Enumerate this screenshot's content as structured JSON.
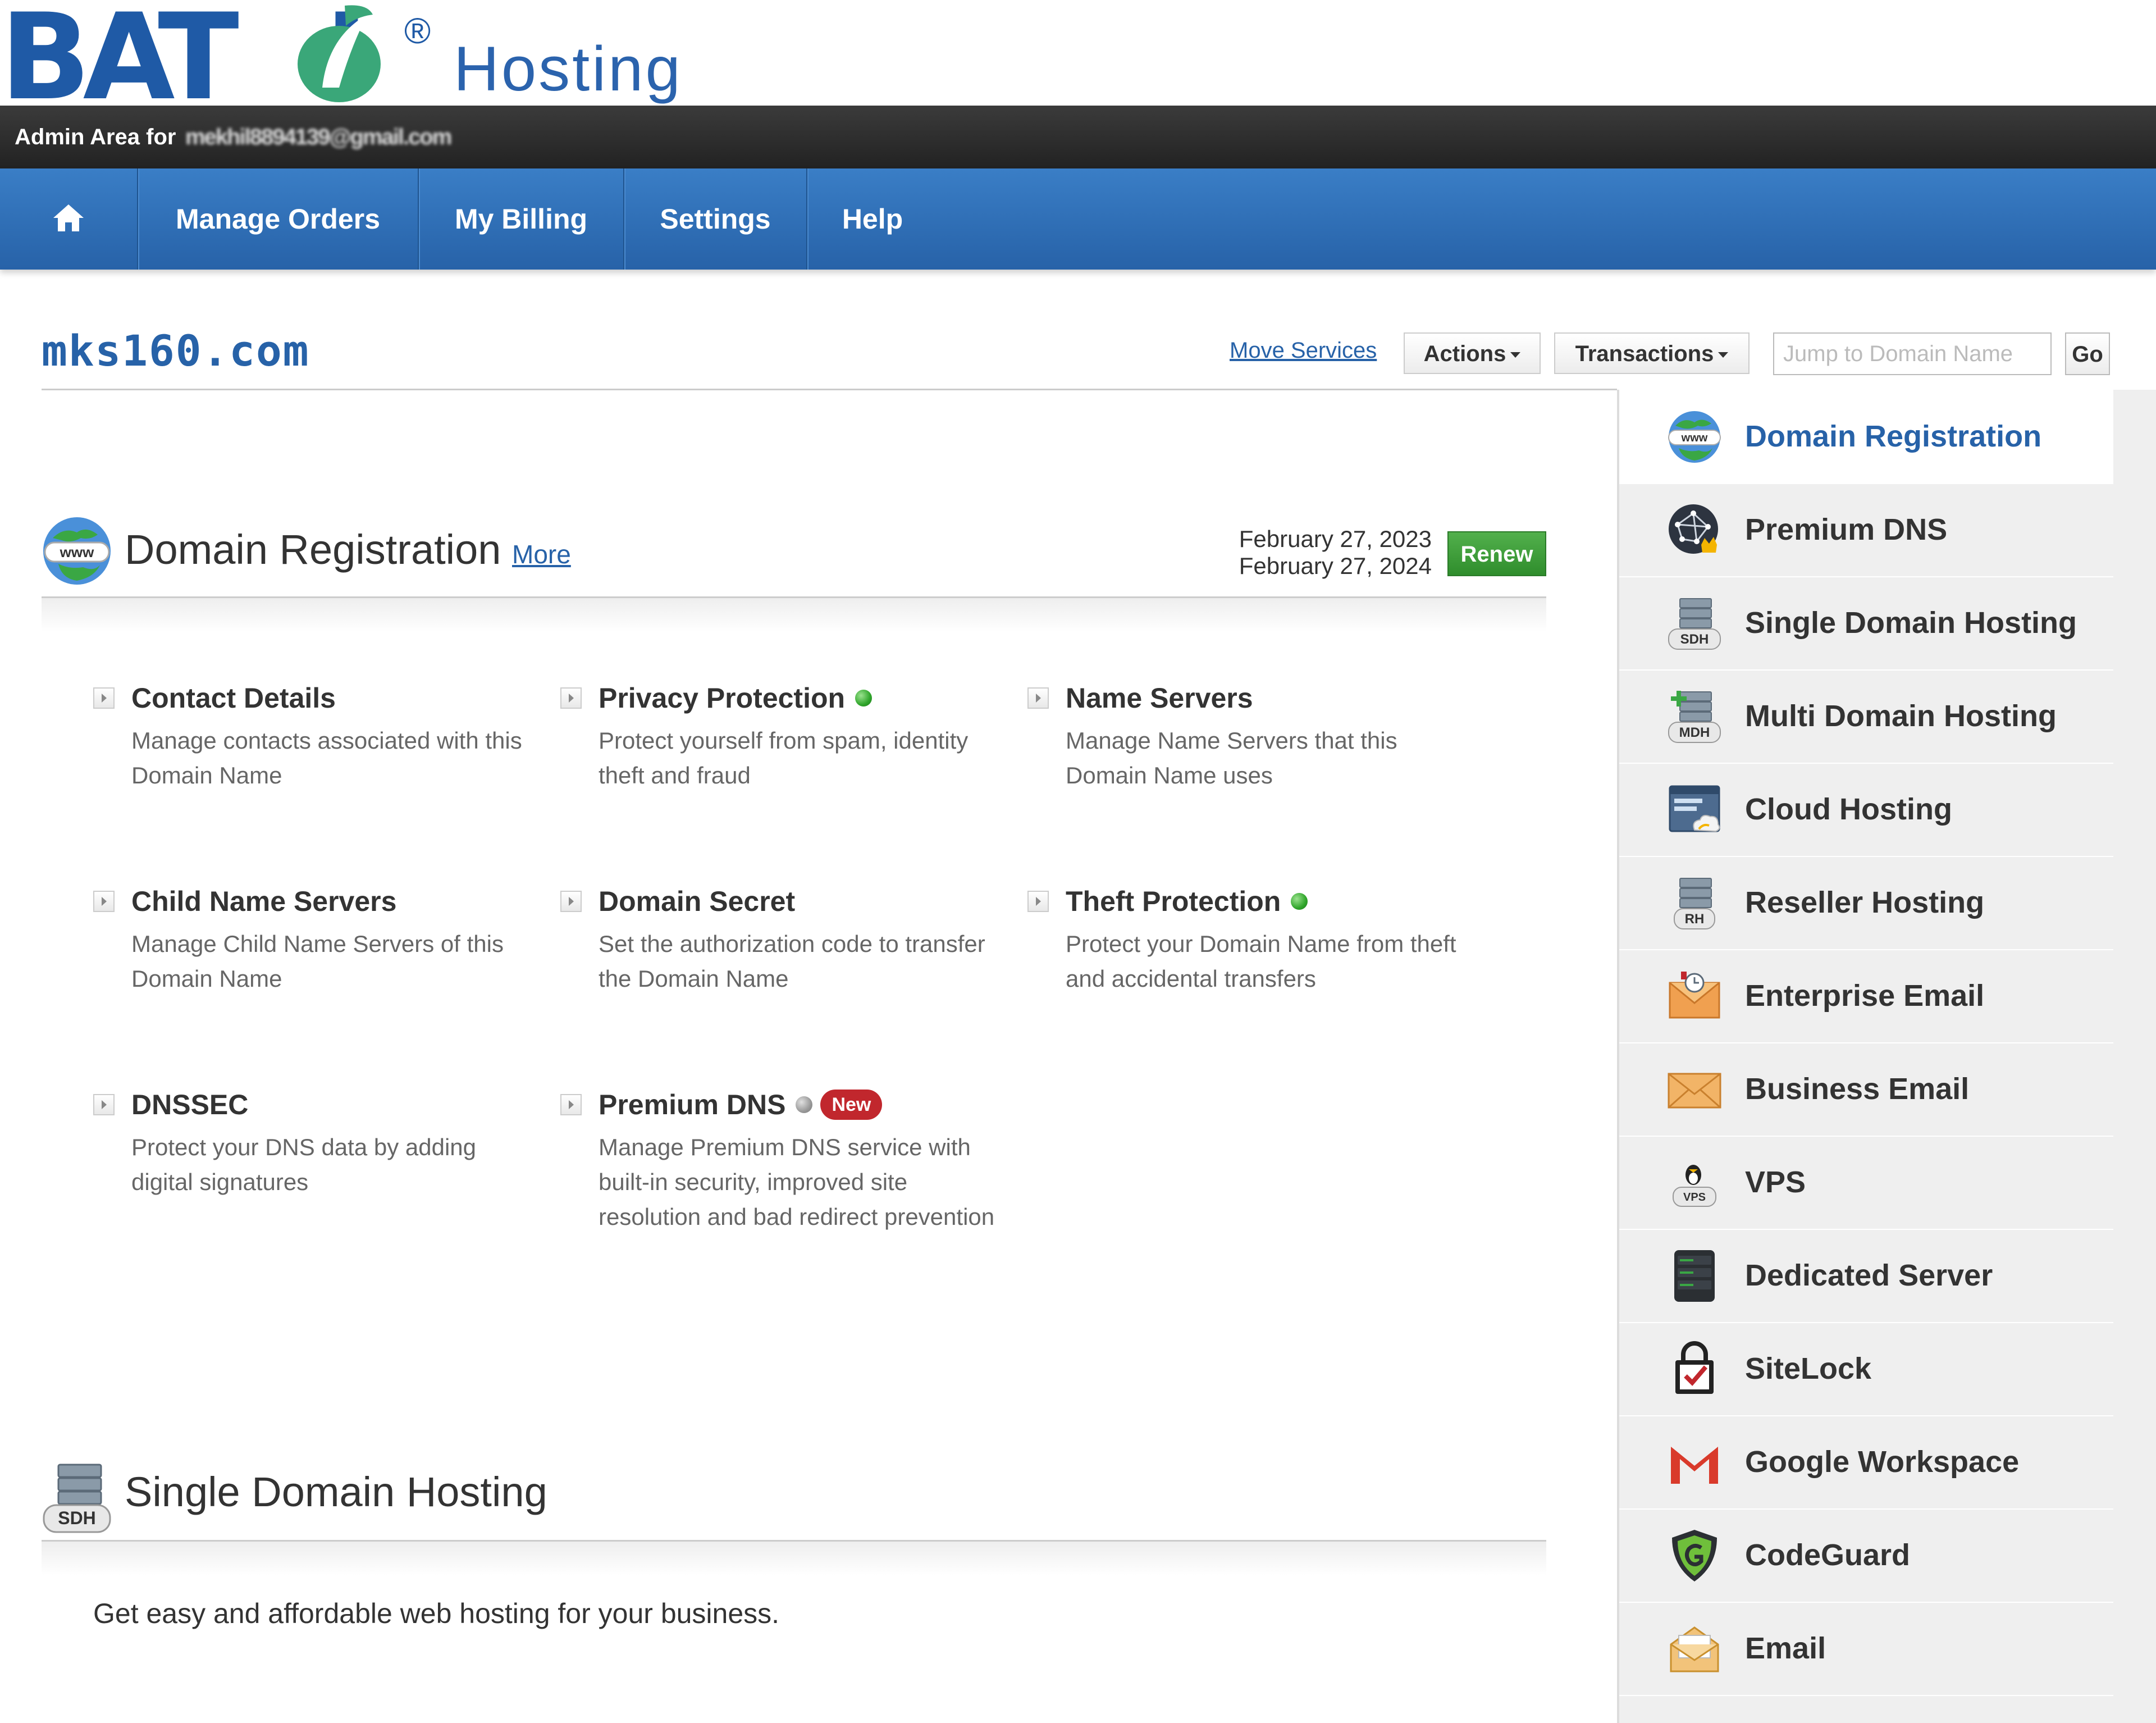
{
  "brand": {
    "logo_word": "BATOI",
    "logo_reg": "®",
    "logo_suffix": "Hosting",
    "color": "#1f5aa6",
    "logo_leaf_color": "#3aa779"
  },
  "admin_bar": {
    "prefix": "Admin Area for",
    "email": "mekhil8894139@gmail.com"
  },
  "nav": {
    "home_icon": "home-icon",
    "items": [
      "Manage Orders",
      "My Billing",
      "Settings",
      "Help"
    ]
  },
  "domain": {
    "name": "mks160.com"
  },
  "toolbar": {
    "move_services": "Move Services",
    "actions": "Actions",
    "transactions": "Transactions",
    "jump_placeholder": "Jump to Domain Name",
    "go": "Go"
  },
  "domain_registration": {
    "title": "Domain Registration",
    "more": "More",
    "date_registered": "February 27, 2023",
    "date_expires": "February 27, 2024",
    "renew": "Renew",
    "features": [
      {
        "title": "Contact Details",
        "desc": "Manage contacts associated with this Domain Name"
      },
      {
        "title": "Privacy Protection",
        "desc": "Protect yourself from spam, identity theft and fraud",
        "status": "green"
      },
      {
        "title": "Name Servers",
        "desc": "Manage Name Servers that this Domain Name uses"
      },
      {
        "title": "Child Name Servers",
        "desc": "Manage Child Name Servers of this Domain Name"
      },
      {
        "title": "Domain Secret",
        "desc": "Set the authorization code to transfer the Domain Name"
      },
      {
        "title": "Theft Protection",
        "desc": "Protect your Domain Name from theft and accidental transfers",
        "status": "green"
      },
      {
        "title": "DNSSEC",
        "desc": "Protect your DNS data by adding digital signatures"
      },
      {
        "title": "Premium DNS",
        "desc": "Manage Premium DNS service with built-in security, improved site resolution and bad redirect prevention",
        "status": "gray",
        "badge": "New"
      }
    ]
  },
  "single_domain_hosting": {
    "title": "Single Domain Hosting",
    "icon_label": "SDH",
    "desc": "Get easy and affordable web hosting for your business."
  },
  "sidebar": {
    "items": [
      {
        "label": "Domain Registration",
        "icon": "www-globe-icon",
        "active": true
      },
      {
        "label": "Premium DNS",
        "icon": "premium-dns-icon"
      },
      {
        "label": "Single Domain Hosting",
        "icon": "sdh-server-icon",
        "icon_text": "SDH"
      },
      {
        "label": "Multi Domain Hosting",
        "icon": "mdh-server-icon",
        "icon_text": "MDH"
      },
      {
        "label": "Cloud Hosting",
        "icon": "cloud-hosting-icon"
      },
      {
        "label": "Reseller Hosting",
        "icon": "rh-server-icon",
        "icon_text": "RH"
      },
      {
        "label": "Enterprise Email",
        "icon": "enterprise-email-icon"
      },
      {
        "label": "Business Email",
        "icon": "envelope-icon"
      },
      {
        "label": "VPS",
        "icon": "vps-penguin-icon",
        "icon_text": "VPS"
      },
      {
        "label": "Dedicated Server",
        "icon": "server-rack-icon"
      },
      {
        "label": "SiteLock",
        "icon": "sitelock-icon"
      },
      {
        "label": "Google Workspace",
        "icon": "gmail-icon"
      },
      {
        "label": "CodeGuard",
        "icon": "codeguard-shield-icon"
      },
      {
        "label": "Email",
        "icon": "email-envelope-icon"
      }
    ]
  },
  "colors": {
    "nav": "#2b6cb3",
    "link": "#2762a8",
    "renew": "#3c9b37",
    "new_badge": "#c1272d",
    "admin_bar": "#2a2a2a"
  }
}
